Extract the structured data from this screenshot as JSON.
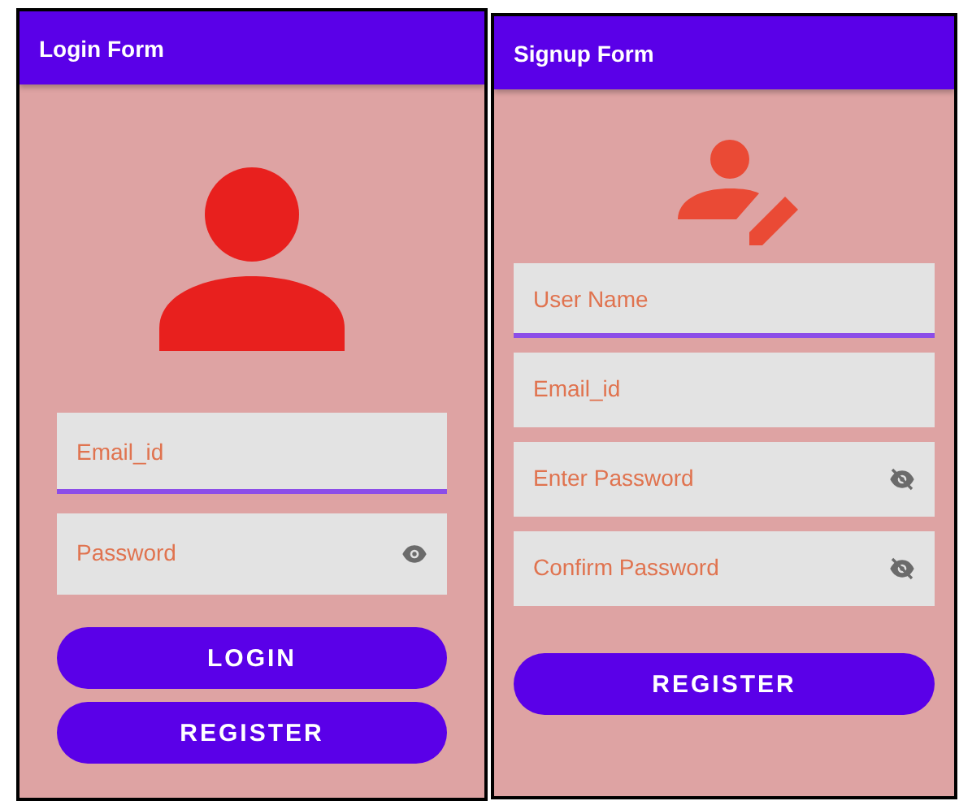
{
  "screens": [
    {
      "title": "Login Form",
      "avatar": {
        "kind": "person"
      },
      "fields": [
        {
          "placeholder": "Email_id",
          "focused": true,
          "kind": "text"
        },
        {
          "placeholder": "Password",
          "focused": false,
          "kind": "password",
          "password_visible": true
        }
      ],
      "buttons": [
        "LOGIN",
        "REGISTER"
      ]
    },
    {
      "title": "Signup Form",
      "avatar": {
        "kind": "person-edit"
      },
      "fields": [
        {
          "placeholder": "User Name",
          "focused": true,
          "kind": "text"
        },
        {
          "placeholder": "Email_id",
          "focused": false,
          "kind": "text"
        },
        {
          "placeholder": "Enter Password",
          "focused": false,
          "kind": "password",
          "password_visible": false
        },
        {
          "placeholder": "Confirm Password",
          "focused": false,
          "kind": "password",
          "password_visible": false
        }
      ],
      "buttons": [
        "REGISTER"
      ]
    }
  ]
}
